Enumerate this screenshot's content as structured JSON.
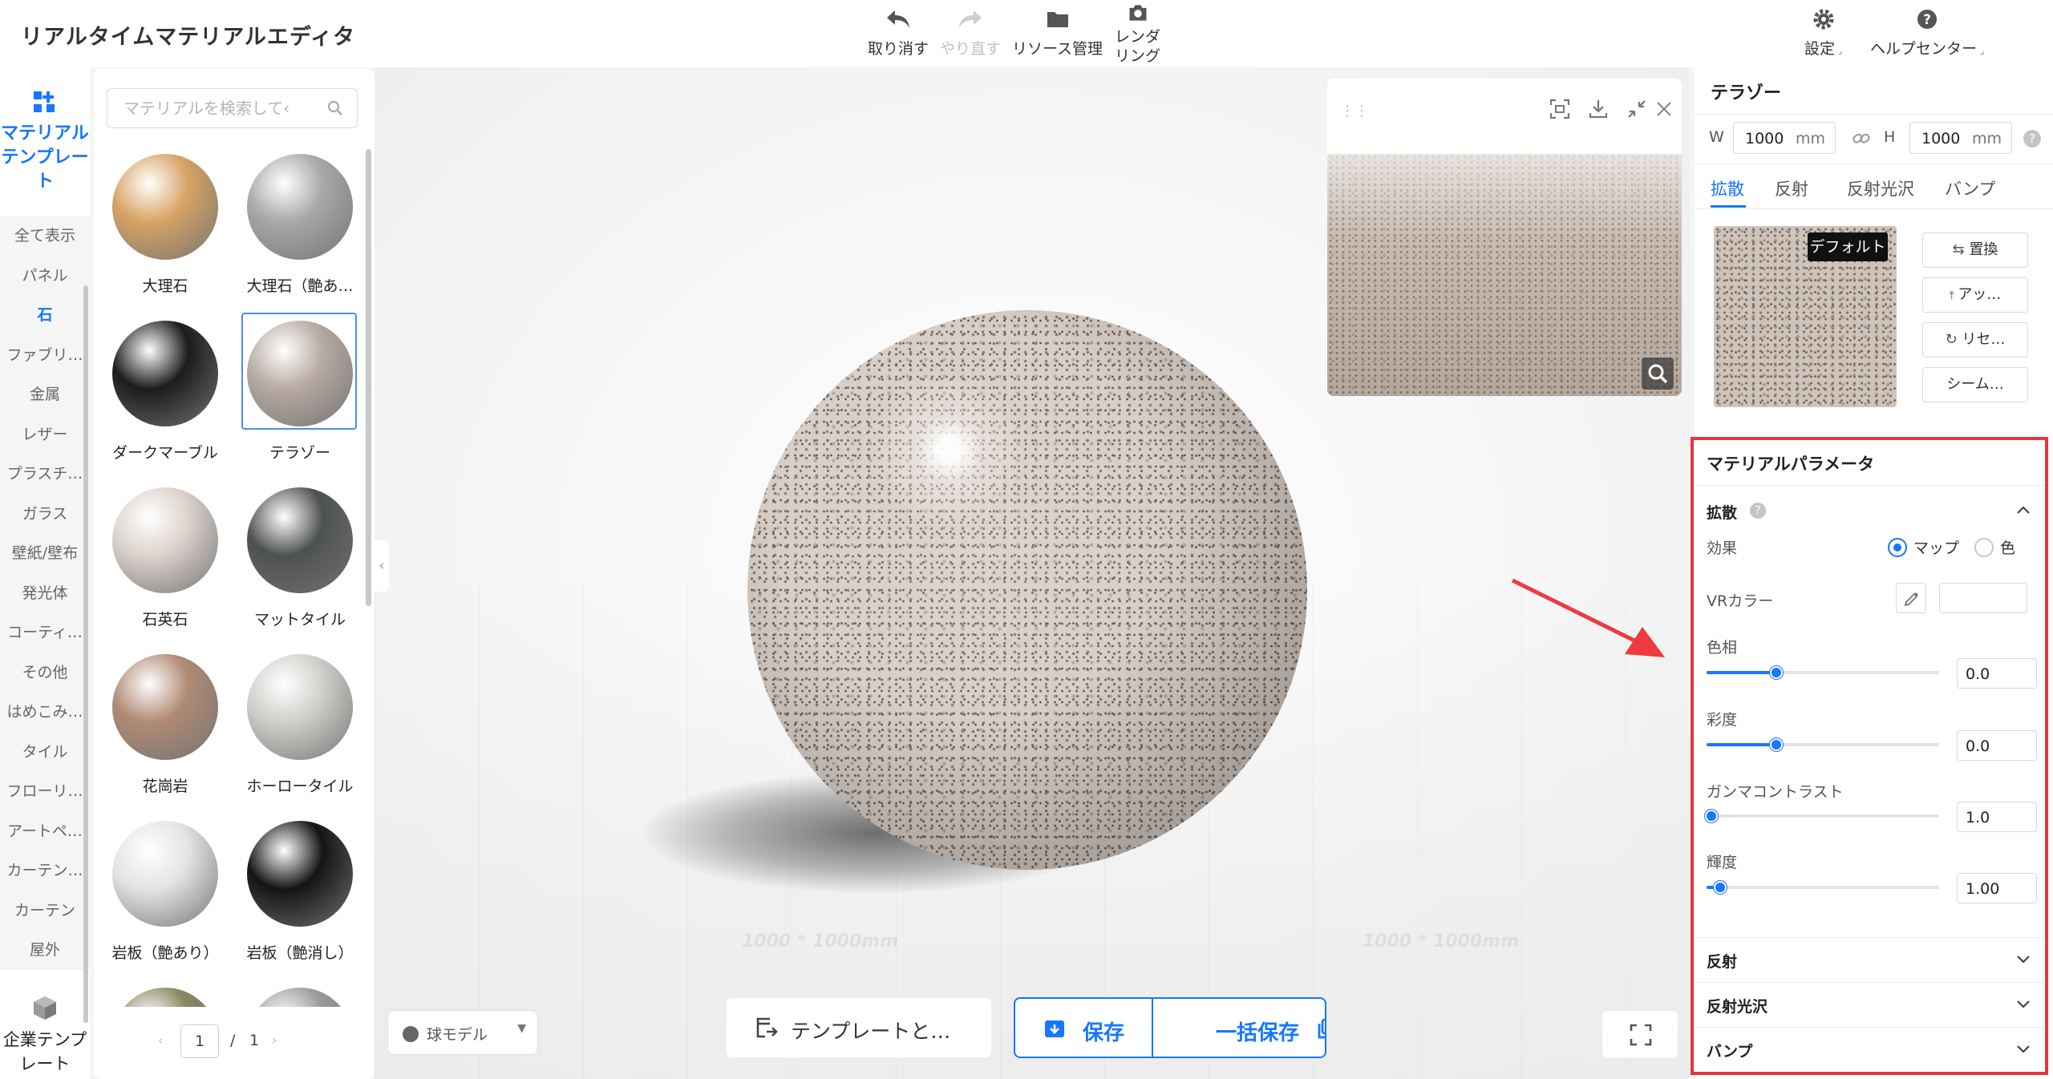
{
  "app": {
    "title": "リアルタイムマテリアルエディタ"
  },
  "toolbar": {
    "undo": "取り消す",
    "redo": "やり直す",
    "resources": "リソース管理",
    "render_line1": "レンダ",
    "render_line2": "リング",
    "settings": "設定",
    "help": "ヘルプセンター"
  },
  "rail": {
    "template_line1": "マテリアル",
    "template_line2": "テンプレー",
    "template_line3": "ト",
    "categories": [
      "全て表示",
      "パネル",
      "石",
      "ファブリ…",
      "金属",
      "レザー",
      "プラスチ…",
      "ガラス",
      "壁紙/壁布",
      "発光体",
      "コーティ…",
      "その他",
      "はめこみ…",
      "タイル",
      "フローリ…",
      "アートペ…",
      "カーテン…",
      "カーテン",
      "屋外"
    ],
    "active_category": "石",
    "enterprise_line1": "企業テンプ",
    "enterprise_line2": "レート"
  },
  "materials": {
    "search_placeholder": "マテリアルを検索して‹",
    "items": [
      {
        "name": "大理石",
        "color": "#d7a364"
      },
      {
        "name": "大理石（艶あ…",
        "color": "#a8a8a8"
      },
      {
        "name": "ダークマーブル",
        "color": "#1c1c1c"
      },
      {
        "name": "テラゾー",
        "color": "#b7aaa2"
      },
      {
        "name": "石英石",
        "color": "#dcd3cd"
      },
      {
        "name": "マットタイル",
        "color": "#4e524f"
      },
      {
        "name": "花崗岩",
        "color": "#b08a74"
      },
      {
        "name": "ホーロータイル",
        "color": "#cfd0cb"
      },
      {
        "name": "岩板（艶あり）",
        "color": "#e4e4e4"
      },
      {
        "name": "岩板（艶消し）",
        "color": "#141414"
      },
      {
        "name": "",
        "color": "#8a8660"
      },
      {
        "name": "",
        "color": "#9a9a9a"
      }
    ],
    "selected": "テラゾー",
    "page_current": "1",
    "page_separator": "/",
    "page_total": "1"
  },
  "viewport": {
    "floor_label_left": "1000 * 1000mm",
    "floor_label_right": "1000 * 1000mm",
    "model_select": "球モデル",
    "template_button": "テンプレートと…",
    "save_button": "保存",
    "batch_save_button": "一括保存"
  },
  "right_panel": {
    "material_name": "テラゾー",
    "width_label": "W",
    "width_value": "1000",
    "width_unit": "mm",
    "height_label": "H",
    "height_value": "1000",
    "height_unit": "mm",
    "tabs": [
      "拡散",
      "反射",
      "反射光沢",
      "バンプ"
    ],
    "active_tab": "拡散",
    "texture_badge": "デフォルト",
    "buttons": {
      "replace": "置換",
      "upload": "アッ…",
      "reset": "リセ…",
      "seamless": "シーム…"
    },
    "params": {
      "header": "マテリアルパラメータ",
      "diffuse_section": "拡散",
      "effect_label": "効果",
      "effect_map": "マップ",
      "effect_color": "色",
      "effect_selected": "マップ",
      "vr_color_label": "VRカラー",
      "hue_label": "色相",
      "hue_value": "0.0",
      "hue_fraction": 0.3,
      "saturation_label": "彩度",
      "saturation_value": "0.0",
      "saturation_fraction": 0.3,
      "gamma_label": "ガンマコントラスト",
      "gamma_value": "1.0",
      "gamma_fraction": 0.0,
      "brightness_label": "輝度",
      "brightness_value": "1.00",
      "brightness_fraction": 0.06,
      "reflection_section": "反射",
      "gloss_section": "反射光沢",
      "bump_section": "バンプ"
    }
  },
  "colors": {
    "accent": "#1677ff",
    "highlight_border": "#e6363b",
    "annotation_arrow": "#ee3b3f"
  }
}
